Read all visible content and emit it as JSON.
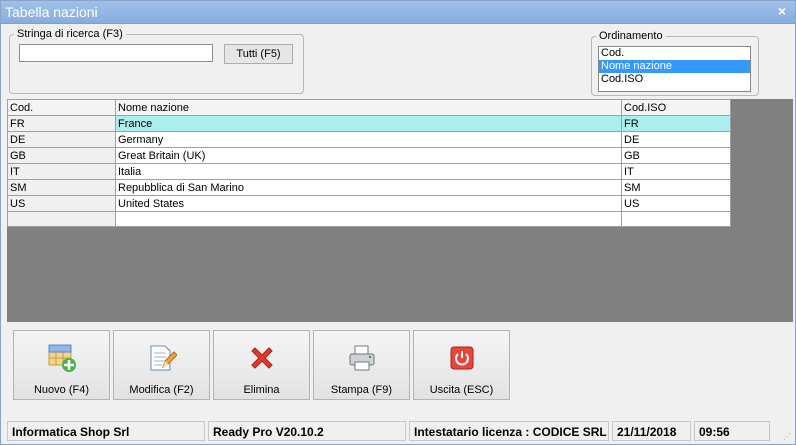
{
  "window": {
    "title": "Tabella nazioni",
    "close_glyph": "×"
  },
  "search": {
    "legend": "Stringa di ricerca (F3)",
    "value": "",
    "placeholder": "",
    "all_button": "Tutti (F5)"
  },
  "ordering": {
    "legend": "Ordinamento",
    "options": [
      {
        "label": "Cod.",
        "selected": false
      },
      {
        "label": "Nome nazione",
        "selected": true
      },
      {
        "label": "Cod.ISO",
        "selected": false
      }
    ]
  },
  "grid": {
    "columns": [
      "Cod.",
      "Nome nazione",
      "Cod.ISO"
    ],
    "rows": [
      {
        "code": "FR",
        "name": "France",
        "iso": "FR",
        "selected": true
      },
      {
        "code": "DE",
        "name": "Germany",
        "iso": "DE",
        "selected": false
      },
      {
        "code": "GB",
        "name": "Great Britain (UK)",
        "iso": "GB",
        "selected": false
      },
      {
        "code": "IT",
        "name": "Italia",
        "iso": "IT",
        "selected": false
      },
      {
        "code": "SM",
        "name": "Repubblica di San Marino",
        "iso": "SM",
        "selected": false
      },
      {
        "code": "US",
        "name": "United States",
        "iso": "US",
        "selected": false
      }
    ]
  },
  "toolbar": {
    "buttons": [
      {
        "label": "Nuovo (F4)",
        "icon": "add-table-icon"
      },
      {
        "label": "Modifica (F2)",
        "icon": "edit-document-icon"
      },
      {
        "label": "Elimina",
        "icon": "red-x-icon"
      },
      {
        "label": "Stampa (F9)",
        "icon": "printer-icon"
      },
      {
        "label": "Uscita (ESC)",
        "icon": "power-icon"
      }
    ]
  },
  "status": {
    "company": "Informatica Shop Srl",
    "version": "Ready Pro V20.10.2",
    "license": "Intestatario licenza : CODICE SRL",
    "date": "21/11/2018",
    "time": "09:56"
  },
  "colors": {
    "title_bar": "#9fc1ea",
    "selection_list": "#3399ff",
    "selection_row": "#aaeeee",
    "grid_background": "#808080"
  }
}
